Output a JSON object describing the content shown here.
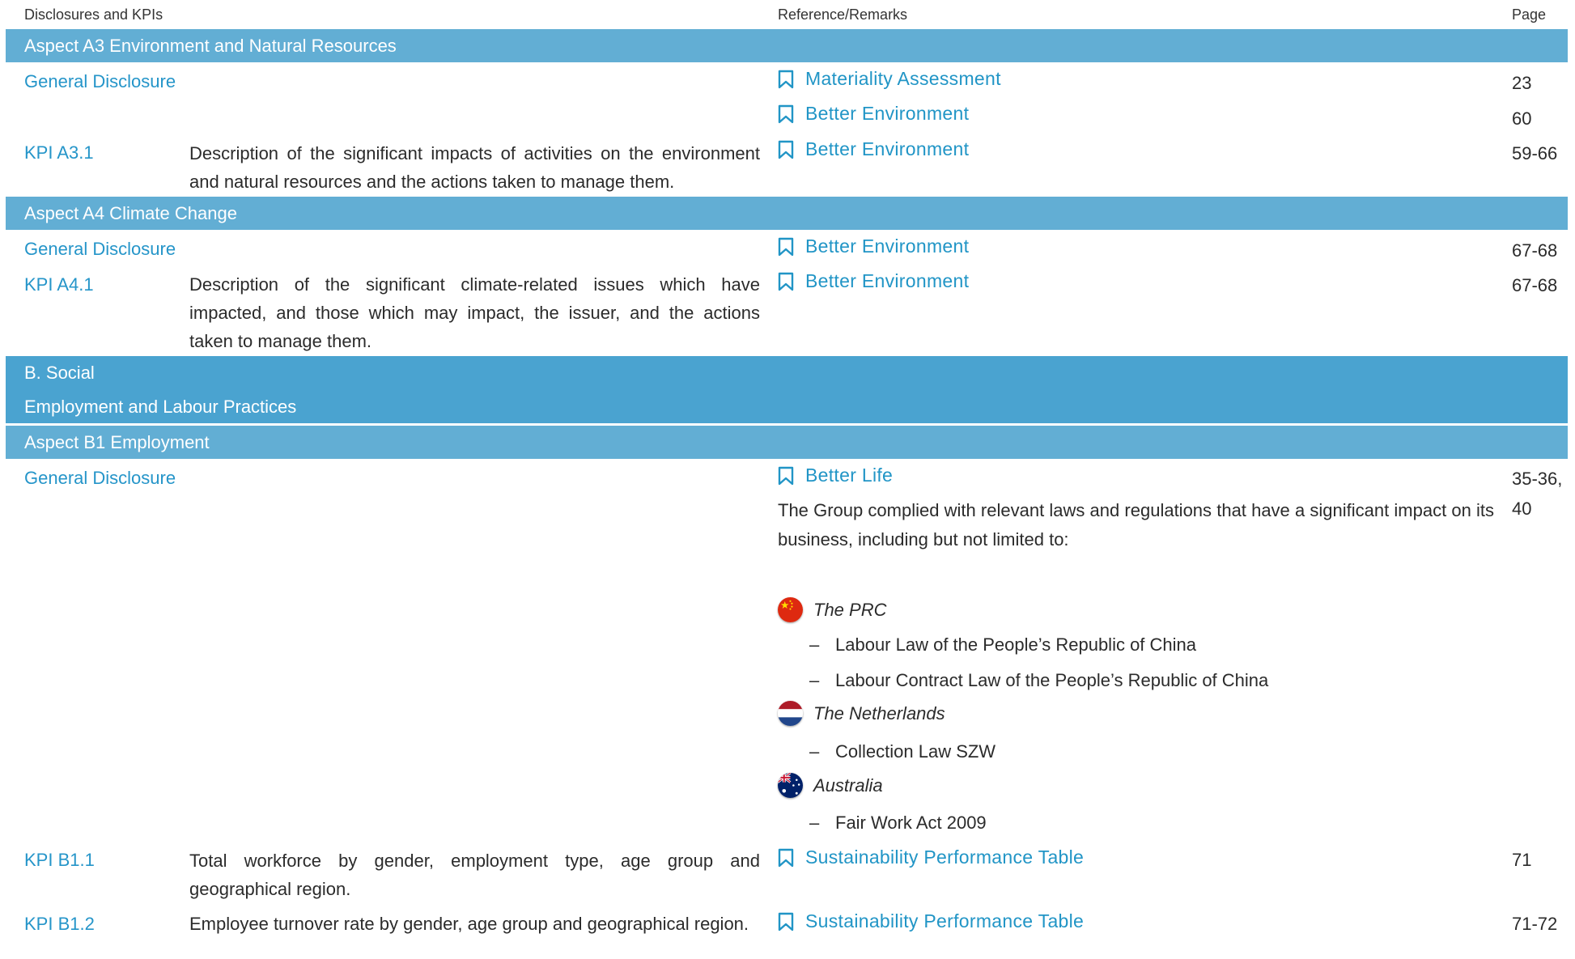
{
  "header": {
    "col1": "Disclosures and KPIs",
    "col2": "Reference/Remarks",
    "col3": "Page"
  },
  "colors": {
    "band": "#62aed4",
    "band_deep": "#4aa3d0",
    "accent": "#2595c9"
  },
  "sections": {
    "a3": {
      "title": "Aspect A3 Environment and Natural Resources",
      "general": "General Disclosure",
      "refs": [
        {
          "label": "Materiality Assessment",
          "page": "23"
        },
        {
          "label": "Better Environment",
          "page": "60"
        }
      ],
      "kpi": {
        "code": "KPI A3.1",
        "desc": "Description of the significant impacts of activities on the environment and natural resources and the actions taken to manage them.",
        "ref": "Better Environment",
        "page": "59-66"
      }
    },
    "a4": {
      "title": "Aspect A4 Climate Change",
      "general": "General Disclosure",
      "ref": "Better Environment",
      "page": "67-68",
      "kpi": {
        "code": "KPI A4.1",
        "desc": "Description of the significant climate-related issues which have impacted, and those which may impact, the issuer, and the actions taken to manage them.",
        "ref": "Better Environment",
        "page": "67-68"
      }
    },
    "b": {
      "title": "B. Social",
      "subtitle": "Employment and Labour Practices"
    },
    "b1": {
      "title": "Aspect B1 Employment",
      "general": "General Disclosure",
      "ref": "Better Life",
      "page_line1": "35-36,",
      "page_line2": "40",
      "paragraph": "The Group complied with relevant laws and regulations that have a significant impact on its business, including but not limited to:",
      "countries": [
        {
          "name": "The PRC",
          "flag_icon": "china-flag-icon",
          "laws": [
            "Labour Law of the People’s Republic of China",
            "Labour Contract Law of the People’s Republic of China"
          ]
        },
        {
          "name": "The Netherlands",
          "flag_icon": "netherlands-flag-icon",
          "laws": [
            "Collection Law SZW"
          ]
        },
        {
          "name": "Australia",
          "flag_icon": "australia-flag-icon",
          "laws": [
            "Fair Work Act 2009"
          ]
        }
      ],
      "dash": "–",
      "kpis": [
        {
          "code": "KPI B1.1",
          "desc": "Total workforce by gender, employment type, age group and geographical region.",
          "ref": "Sustainability Performance Table",
          "page": "71"
        },
        {
          "code": "KPI B1.2",
          "desc": "Employee turnover rate by gender, age group and geographical region.",
          "ref": "Sustainability Performance Table",
          "page": "71-72"
        }
      ]
    }
  }
}
